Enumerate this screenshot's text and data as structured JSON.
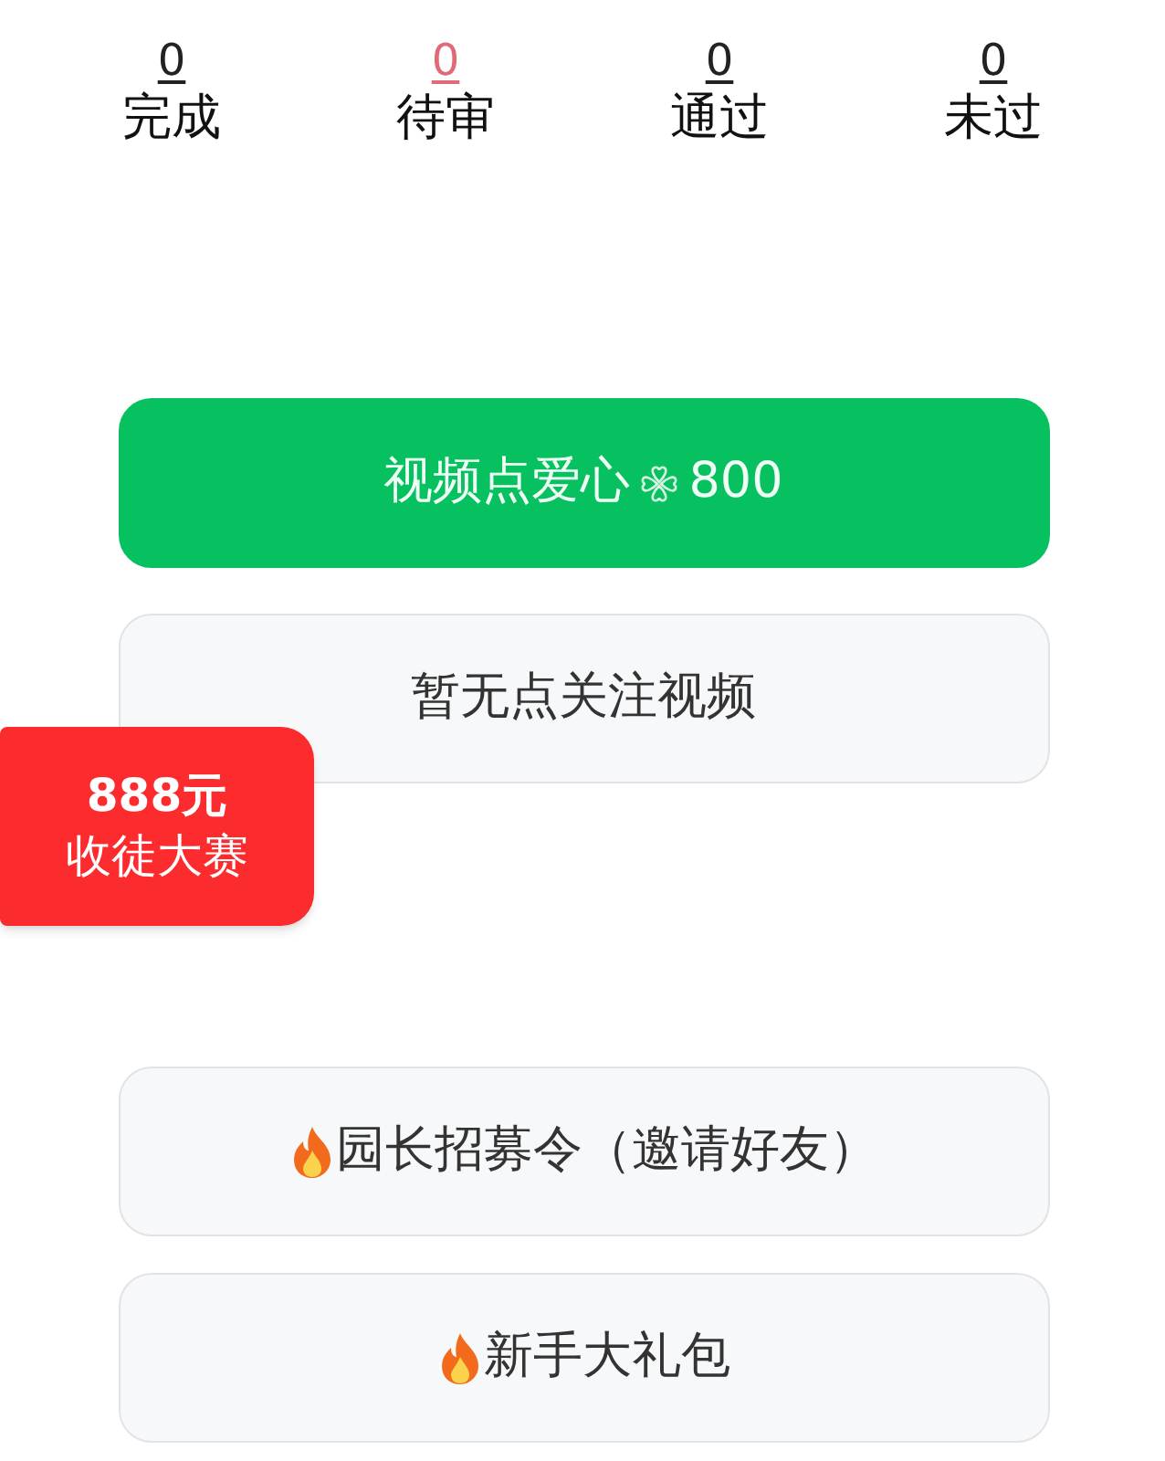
{
  "stats": [
    {
      "value": "0",
      "label": "完成",
      "color": "#222222"
    },
    {
      "value": "0",
      "label": "待审",
      "color": "#e06a78"
    },
    {
      "value": "0",
      "label": "通过",
      "color": "#222222"
    },
    {
      "value": "0",
      "label": "未过",
      "color": "#222222"
    }
  ],
  "top_buttons": [
    {
      "kind": "primary",
      "label": "视频点爱心 ",
      "suffix": "800"
    },
    {
      "kind": "plain",
      "label": "暂无点关注视频"
    }
  ],
  "promo_badge": {
    "amount": "888元",
    "title": "收徒大赛"
  },
  "bottom_buttons": [
    {
      "kind": "fire",
      "label": "园长招募令（邀请好友）"
    },
    {
      "kind": "fire",
      "label": "新手大礼包"
    }
  ]
}
